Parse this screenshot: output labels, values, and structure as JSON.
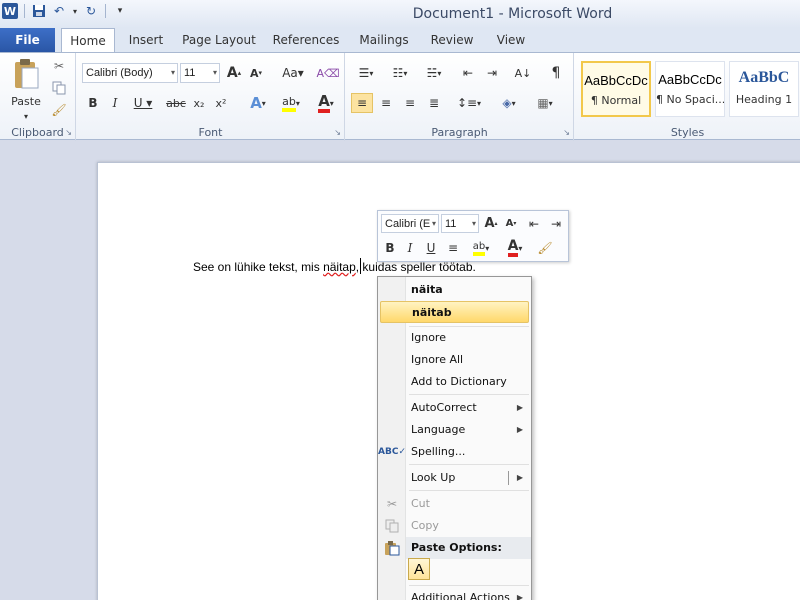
{
  "window": {
    "title": "Document1 - Microsoft Word"
  },
  "tabs": [
    {
      "label": "File"
    },
    {
      "label": "Home"
    },
    {
      "label": "Insert"
    },
    {
      "label": "Page Layout"
    },
    {
      "label": "References"
    },
    {
      "label": "Mailings"
    },
    {
      "label": "Review"
    },
    {
      "label": "View"
    }
  ],
  "ribbon": {
    "clipboard": {
      "label": "Clipboard",
      "paste_label": "Paste"
    },
    "font": {
      "label": "Font",
      "font_name": "Calibri (Body)",
      "font_size": "11"
    },
    "paragraph": {
      "label": "Paragraph"
    },
    "styles": {
      "label": "Styles",
      "items": [
        {
          "sample": "AaBbCcDc",
          "name": "¶ Normal"
        },
        {
          "sample": "AaBbCcDc",
          "name": "¶ No Spaci..."
        },
        {
          "sample": "AaBbC",
          "name": "Heading 1"
        }
      ]
    }
  },
  "document": {
    "text_before": "See on lühike tekst, mis ",
    "misspelled": "näitap",
    "text_after": ", kuidas speller töötab."
  },
  "mini_toolbar": {
    "font_name": "Calibri (E",
    "font_size": "11"
  },
  "context_menu": {
    "suggestions": [
      "näita",
      "näitab"
    ],
    "ignore": "Ignore",
    "ignore_all": "Ignore All",
    "add_to_dictionary": "Add to Dictionary",
    "autocorrect": "AutoCorrect",
    "language": "Language",
    "spelling": "Spelling...",
    "look_up": "Look Up",
    "cut": "Cut",
    "copy": "Copy",
    "paste_options": "Paste Options:",
    "additional_actions": "Additional Actions"
  },
  "colors": {
    "accent": "#2b579a",
    "highlight": "#ffd86b",
    "spell_error": "#e02020"
  }
}
